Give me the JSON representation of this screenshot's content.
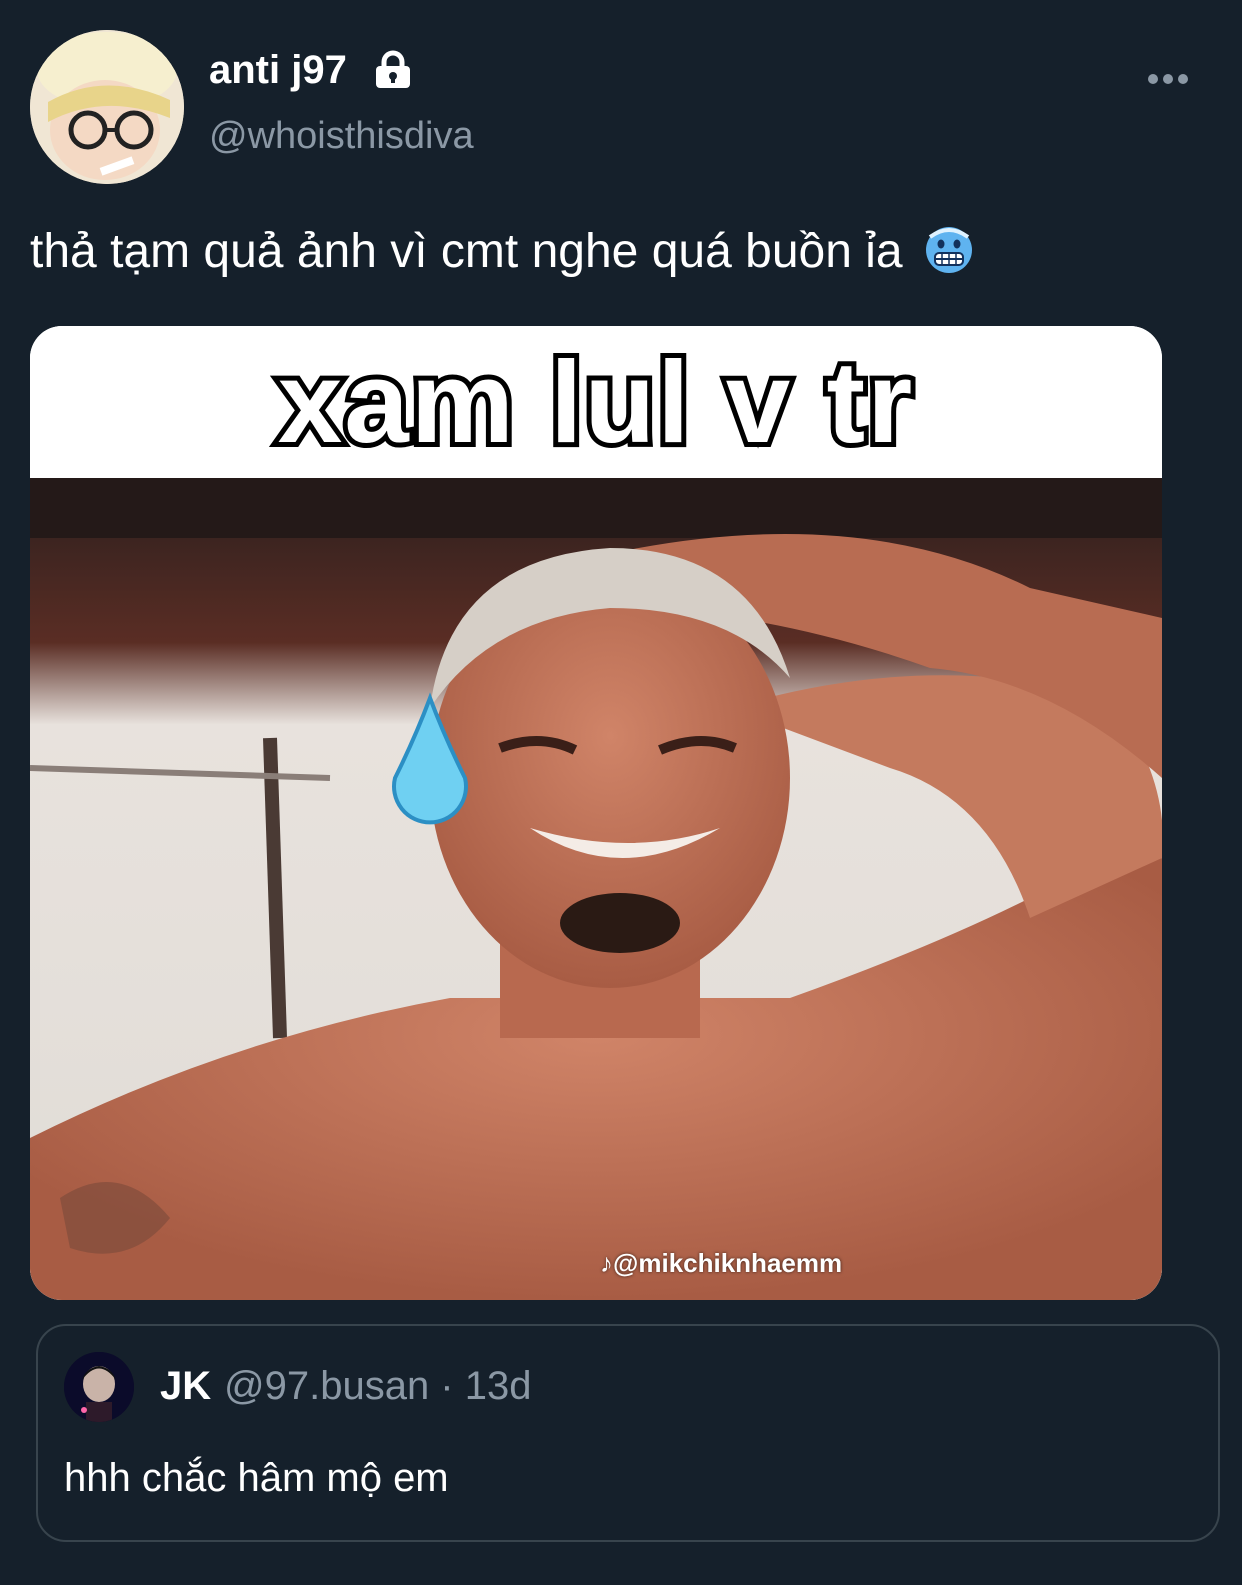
{
  "tweet": {
    "display_name": "anti j97",
    "handle": "@whoisthisdiva",
    "text": "thả tạm quả ảnh vì cmt nghe quá buồn ỉa",
    "lock_icon": "lock-icon",
    "more_icon": "more-horizontal-icon",
    "emoji": "cold-face-emoji"
  },
  "media": {
    "caption": "xam lul v tr",
    "watermark": "@mikchiknhaemm"
  },
  "quote": {
    "name": "JK",
    "handle": "@97.busan",
    "separator": "·",
    "time": "13d",
    "meta": "@97.busan · 13d",
    "text": "hhh chắc hâm mộ em"
  },
  "colors": {
    "background": "#15202b",
    "secondary_text": "#8b98a5",
    "border": "#38444d"
  }
}
